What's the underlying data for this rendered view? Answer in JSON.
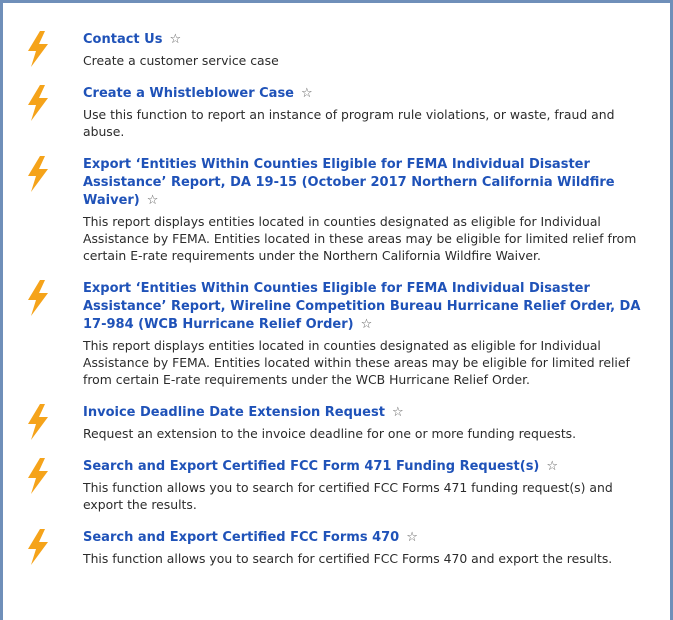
{
  "items": [
    {
      "title": "Contact Us",
      "description": "Create a customer service case"
    },
    {
      "title": "Create a Whistleblower Case",
      "description": "Use this function to report an instance of program rule violations, or waste, fraud and abuse."
    },
    {
      "title": "Export ‘Entities Within Counties Eligible for FEMA Individual Disaster Assistance’ Report, DA 19-15 (October 2017 Northern California Wildfire Waiver)",
      "description": "This report displays entities located in counties designated as eligible for Individual Assistance by FEMA. Entities located in these areas may be eligible for limited relief from certain E-rate requirements under the Northern California Wildfire Waiver."
    },
    {
      "title": "Export ‘Entities Within Counties Eligible for FEMA Individual Disaster Assistance’ Report, Wireline Competition Bureau Hurricane Relief Order, DA 17-984 (WCB Hurricane Relief Order)",
      "description": "This report displays entities located in counties designated as eligible for Individual Assistance by FEMA. Entities located within these areas may be eligible for limited relief from certain E-rate requirements under the WCB Hurricane Relief Order."
    },
    {
      "title": "Invoice Deadline Date Extension Request",
      "description": "Request an extension to the invoice deadline for one or more funding requests."
    },
    {
      "title": "Search and Export Certified FCC Form 471 Funding Request(s)",
      "description": "This function allows you to search for certified FCC Forms 471 funding request(s) and export the results."
    },
    {
      "title": "Search and Export Certified FCC Forms 470",
      "description": "This function allows you to search for certified FCC Forms 470 and export the results."
    }
  ],
  "star_glyph": "☆",
  "icon_name": "lightning-bolt-icon",
  "colors": {
    "accent": "#f5a31a",
    "link": "#1f52b8",
    "border": "#6f8fb9"
  }
}
